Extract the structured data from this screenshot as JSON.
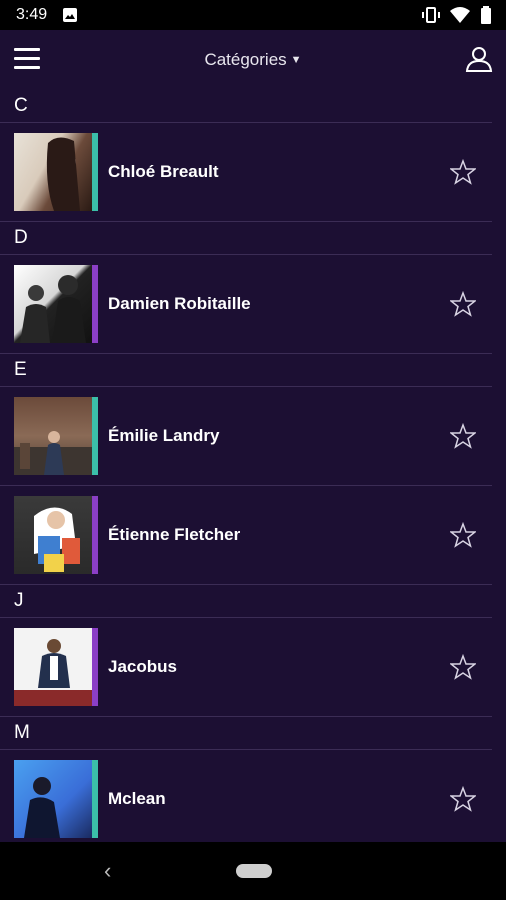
{
  "status_bar": {
    "time": "3:49"
  },
  "app_bar": {
    "title": "Catégories"
  },
  "sections": [
    {
      "letter": "C",
      "artists": [
        {
          "name": "Chloé Breault",
          "accent": "#3bbfa9"
        }
      ]
    },
    {
      "letter": "D",
      "artists": [
        {
          "name": "Damien Robitaille",
          "accent": "#8b3fc6"
        }
      ]
    },
    {
      "letter": "E",
      "artists": [
        {
          "name": "Émilie Landry",
          "accent": "#3bbfa9"
        },
        {
          "name": "Étienne Fletcher",
          "accent": "#8b3fc6"
        }
      ]
    },
    {
      "letter": "J",
      "artists": [
        {
          "name": "Jacobus",
          "accent": "#8b3fc6"
        }
      ]
    },
    {
      "letter": "M",
      "artists": [
        {
          "name": "Mclean",
          "accent": "#3bbfa9"
        }
      ]
    }
  ]
}
